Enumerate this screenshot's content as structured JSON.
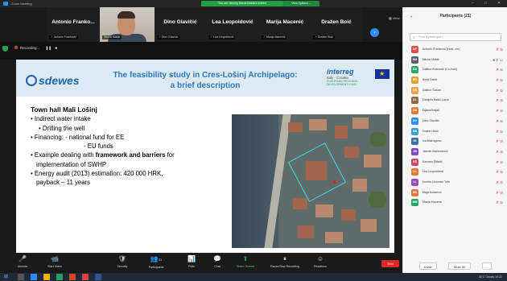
{
  "window": {
    "title": "Zoom Meeting",
    "viewing_banner": "You are viewing Nikola Matak's screen",
    "view_options": "View Options"
  },
  "gallery": {
    "view_label": "View",
    "tiles": [
      {
        "name": "Antonio Franko...",
        "sub": "Antonio Franković"
      },
      {
        "name": "",
        "sub": "Nikola Matak"
      },
      {
        "name": "Dino Glavičić",
        "sub": "Dino Glavičić"
      },
      {
        "name": "Lea Leopoldović",
        "sub": "Lea Leopoldović"
      },
      {
        "name": "Marija Macenić",
        "sub": "Marija Macenić"
      },
      {
        "name": "Dražen Boić",
        "sub": "Dražen Boić"
      }
    ]
  },
  "recording": {
    "label": "Recording..."
  },
  "slide": {
    "logo_left": "sdewes",
    "title_line1": "The feasibility study in Cres-Lošinj Archipelago:",
    "title_line2": "a brief description",
    "logo_right_main": "interreg",
    "logo_right_sub": "Italy - Croatia",
    "logo_right_tag": "EUROPEAN REGIONAL DEVELOPMENT FUND",
    "heading": "Town hall Mali Lošinj",
    "bullets": [
      {
        "level": 1,
        "text": "• Indirect water intake"
      },
      {
        "level": 2,
        "text": "• Drilling the well"
      },
      {
        "level": 1,
        "text": "• Financing:   - national fund for EE"
      },
      {
        "level": 3,
        "text": "- EU funds"
      },
      {
        "level": 1,
        "pre": "• Example dealing with ",
        "bold": "framework and barriers",
        "post": " for"
      },
      {
        "level": 4,
        "text": "implementation of SWHP"
      },
      {
        "level": 1,
        "text": "• Energy audit (2013) estimation: 420 000 HRK,"
      },
      {
        "level": 4,
        "text": "payback – 11 years"
      }
    ]
  },
  "toolbar": {
    "items": [
      {
        "label": "Unmute",
        "icon": "🎤"
      },
      {
        "label": "Start Video",
        "icon": "📹"
      },
      {
        "label": "Security",
        "icon": "🛡"
      },
      {
        "label": "Participants",
        "icon": "👥"
      },
      {
        "label": "Polls",
        "icon": "📊"
      },
      {
        "label": "Chat",
        "icon": "💬"
      },
      {
        "label": "Share Screen",
        "icon": "⬆"
      },
      {
        "label": "Pause/Stop Recording",
        "icon": "⏸"
      },
      {
        "label": "Reactions",
        "icon": "☺"
      }
    ],
    "participants_count": "21",
    "end_label": "End"
  },
  "participants": {
    "title": "Participants (21)",
    "search_placeholder": "Find a participant",
    "list": [
      {
        "initials": "AF",
        "color": "#d9534f",
        "name": "Antonio Franković (Host, me)"
      },
      {
        "initials": "NM",
        "color": "#5a6270",
        "name": "Nikola Matak"
      },
      {
        "initials": "DA",
        "color": "#2aa86b",
        "name": "Dalibor Ananović (Co-host)"
      },
      {
        "initials": "BD",
        "color": "#e0a030",
        "name": "Boris Dabić"
      },
      {
        "initials": "DŠ",
        "color": "#f0a04a",
        "name": "Dalibor Šoban"
      },
      {
        "initials": "DL",
        "color": "#8b6a4a",
        "name": "Danijela Bašić Lazar"
      },
      {
        "initials": "DB",
        "color": "#e07b39",
        "name": "Dijana Beljak"
      },
      {
        "initials": "DG",
        "color": "#2d8cff",
        "name": "Dino Glavičić"
      },
      {
        "initials": "DB",
        "color": "#3a9fd0",
        "name": "Dražen Boić"
      },
      {
        "initials": "IM",
        "color": "#3a6ea5",
        "name": "Iva Mažugorac"
      },
      {
        "initials": "JM",
        "color": "#7a4fc4",
        "name": "Jasmin Mahmutović"
      },
      {
        "initials": "KŠ",
        "color": "#c94a6e",
        "name": "Karmen Šiftarić"
      },
      {
        "initials": "LL",
        "color": "#e07b39",
        "name": "Lea Leopoldović"
      },
      {
        "initials": "LL",
        "color": "#9a4fb8",
        "name": "Lorella Limoncin Toth"
      },
      {
        "initials": "MK",
        "color": "#e07b39",
        "name": "Maja Kolarević"
      },
      {
        "initials": "MM",
        "color": "#2aa86b",
        "name": "Marija Macenić"
      }
    ],
    "invite_label": "Invite",
    "mute_all_label": "Mute All"
  },
  "taskbar": {
    "weather": "15°C Cloudy",
    "time": "10:22"
  }
}
